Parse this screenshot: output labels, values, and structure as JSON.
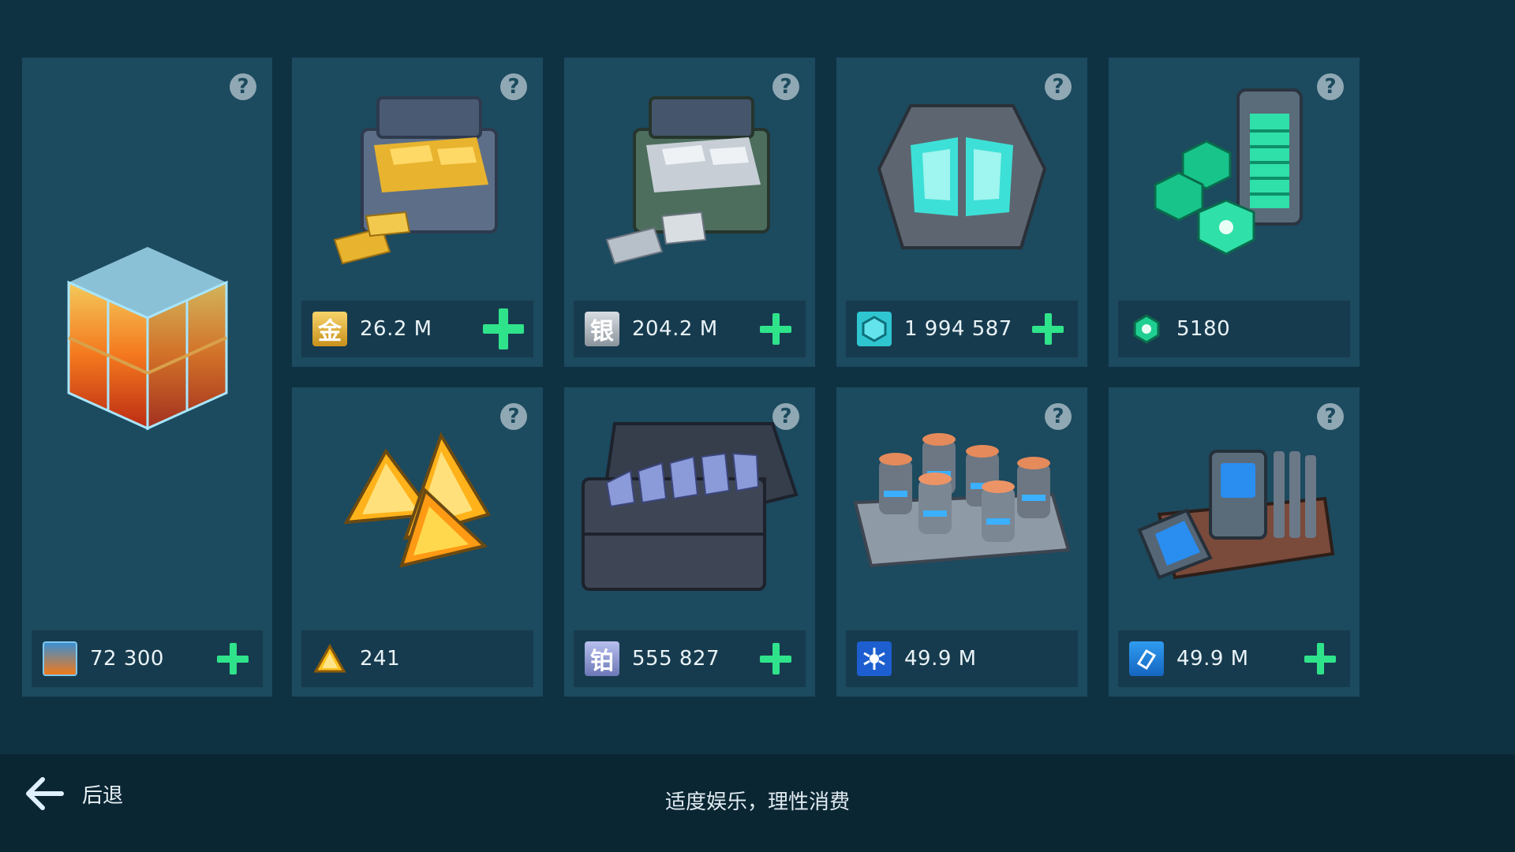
{
  "cards": [
    {
      "name": "cube-resource",
      "amount": "72 300",
      "has_plus": true,
      "icon_name": "orange-cube-icon"
    },
    {
      "name": "gold",
      "amount": "26.2 M",
      "has_plus": true,
      "icon_char": "金",
      "icon_name": "gold-icon"
    },
    {
      "name": "silver",
      "amount": "204.2 M",
      "has_plus": true,
      "icon_char": "银",
      "icon_name": "silver-icon"
    },
    {
      "name": "crystal",
      "amount": "1 994 587",
      "has_plus": true,
      "icon_name": "hex-crystal-icon"
    },
    {
      "name": "green-token",
      "amount": "5180",
      "has_plus": false,
      "icon_name": "green-hex-token-icon"
    },
    {
      "name": "triangle-shard",
      "amount": "241",
      "has_plus": false,
      "icon_name": "triangle-shard-icon"
    },
    {
      "name": "platinum",
      "amount": "555 827",
      "has_plus": true,
      "icon_char": "铂",
      "icon_name": "platinum-icon"
    },
    {
      "name": "atom-resource",
      "amount": "49.9 M",
      "has_plus": false,
      "icon_name": "atom-icon"
    },
    {
      "name": "chip-resource",
      "amount": "49.9 M",
      "has_plus": true,
      "icon_name": "chip-icon"
    }
  ],
  "footer": {
    "back_label": "后退",
    "notice": "适度娱乐，理性消费"
  },
  "colors": {
    "background": "#0f3243",
    "card": "#1c4a5f",
    "bar": "#173b4e",
    "plus": "#2fe38b",
    "footer": "#0b2633"
  }
}
